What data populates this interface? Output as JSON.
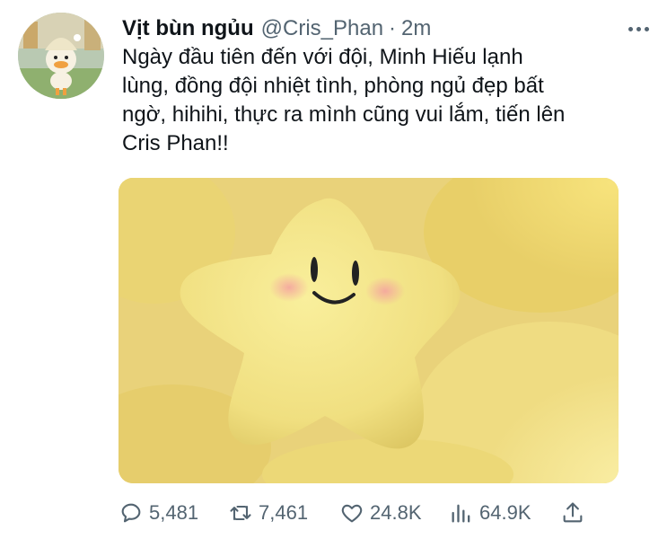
{
  "user": {
    "display_name": "Vịt bùn ngủu",
    "handle": "@Cris_Phan",
    "separator": "·",
    "time": "2m"
  },
  "tweet": {
    "lines": [
      "Ngày đầu tiên đến với đội, Minh Hiếu lạnh",
      "lùng, đồng đội nhiệt tình, phòng ngủ đẹp bất",
      "ngờ, hihihi, thực ra mình cũng vui lắm, tiến lên",
      "Cris Phan!!"
    ]
  },
  "media": {
    "subject": "yellow plush star toy with smiling face"
  },
  "actions": {
    "replies": "5,481",
    "retweets": "7,461",
    "likes": "24.8K",
    "views": "64.9K"
  },
  "icons": [
    "more-icon",
    "reply-icon",
    "retweet-icon",
    "like-icon",
    "views-icon",
    "share-icon"
  ],
  "colors": {
    "text": "#0f1419",
    "secondary": "#536471",
    "plush": "#f2e07a"
  }
}
